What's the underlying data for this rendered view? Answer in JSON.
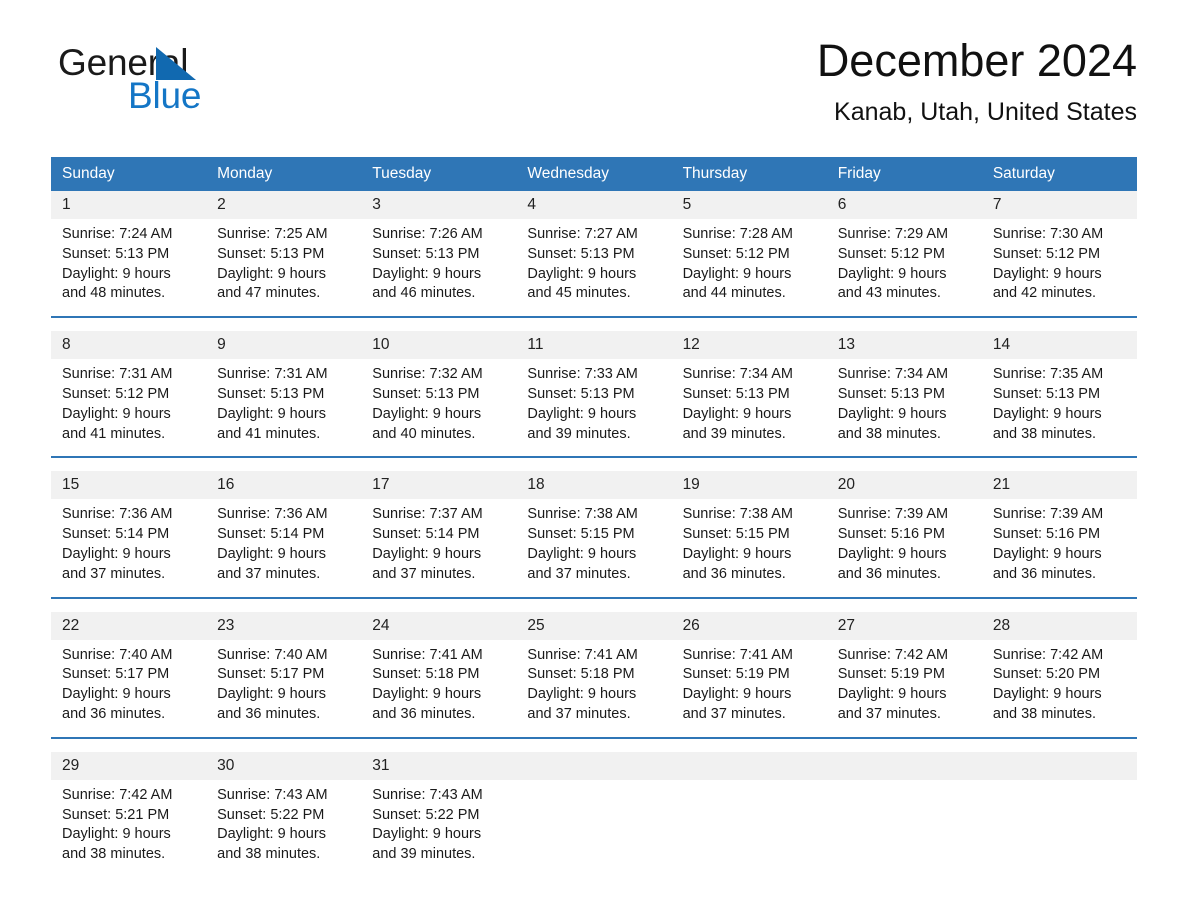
{
  "logo": {
    "word_one": "General",
    "word_two": "Blue",
    "triangle_color": "#1169b0",
    "blue_color": "#1476c6"
  },
  "header": {
    "month_title": "December 2024",
    "location": "Kanab, Utah, United States"
  },
  "colors": {
    "header_blue": "#2f76b6",
    "daynum_band": "#f1f1f1",
    "separator": "#2f76b6",
    "page_background": "#ffffff"
  },
  "calendar": {
    "weekday_headers": [
      "Sunday",
      "Monday",
      "Tuesday",
      "Wednesday",
      "Thursday",
      "Friday",
      "Saturday"
    ],
    "weeks": [
      [
        {
          "day": "1",
          "sunrise": "Sunrise: 7:24 AM",
          "sunset": "Sunset: 5:13 PM",
          "daylight_1": "Daylight: 9 hours",
          "daylight_2": "and 48 minutes."
        },
        {
          "day": "2",
          "sunrise": "Sunrise: 7:25 AM",
          "sunset": "Sunset: 5:13 PM",
          "daylight_1": "Daylight: 9 hours",
          "daylight_2": "and 47 minutes."
        },
        {
          "day": "3",
          "sunrise": "Sunrise: 7:26 AM",
          "sunset": "Sunset: 5:13 PM",
          "daylight_1": "Daylight: 9 hours",
          "daylight_2": "and 46 minutes."
        },
        {
          "day": "4",
          "sunrise": "Sunrise: 7:27 AM",
          "sunset": "Sunset: 5:13 PM",
          "daylight_1": "Daylight: 9 hours",
          "daylight_2": "and 45 minutes."
        },
        {
          "day": "5",
          "sunrise": "Sunrise: 7:28 AM",
          "sunset": "Sunset: 5:12 PM",
          "daylight_1": "Daylight: 9 hours",
          "daylight_2": "and 44 minutes."
        },
        {
          "day": "6",
          "sunrise": "Sunrise: 7:29 AM",
          "sunset": "Sunset: 5:12 PM",
          "daylight_1": "Daylight: 9 hours",
          "daylight_2": "and 43 minutes."
        },
        {
          "day": "7",
          "sunrise": "Sunrise: 7:30 AM",
          "sunset": "Sunset: 5:12 PM",
          "daylight_1": "Daylight: 9 hours",
          "daylight_2": "and 42 minutes."
        }
      ],
      [
        {
          "day": "8",
          "sunrise": "Sunrise: 7:31 AM",
          "sunset": "Sunset: 5:12 PM",
          "daylight_1": "Daylight: 9 hours",
          "daylight_2": "and 41 minutes."
        },
        {
          "day": "9",
          "sunrise": "Sunrise: 7:31 AM",
          "sunset": "Sunset: 5:13 PM",
          "daylight_1": "Daylight: 9 hours",
          "daylight_2": "and 41 minutes."
        },
        {
          "day": "10",
          "sunrise": "Sunrise: 7:32 AM",
          "sunset": "Sunset: 5:13 PM",
          "daylight_1": "Daylight: 9 hours",
          "daylight_2": "and 40 minutes."
        },
        {
          "day": "11",
          "sunrise": "Sunrise: 7:33 AM",
          "sunset": "Sunset: 5:13 PM",
          "daylight_1": "Daylight: 9 hours",
          "daylight_2": "and 39 minutes."
        },
        {
          "day": "12",
          "sunrise": "Sunrise: 7:34 AM",
          "sunset": "Sunset: 5:13 PM",
          "daylight_1": "Daylight: 9 hours",
          "daylight_2": "and 39 minutes."
        },
        {
          "day": "13",
          "sunrise": "Sunrise: 7:34 AM",
          "sunset": "Sunset: 5:13 PM",
          "daylight_1": "Daylight: 9 hours",
          "daylight_2": "and 38 minutes."
        },
        {
          "day": "14",
          "sunrise": "Sunrise: 7:35 AM",
          "sunset": "Sunset: 5:13 PM",
          "daylight_1": "Daylight: 9 hours",
          "daylight_2": "and 38 minutes."
        }
      ],
      [
        {
          "day": "15",
          "sunrise": "Sunrise: 7:36 AM",
          "sunset": "Sunset: 5:14 PM",
          "daylight_1": "Daylight: 9 hours",
          "daylight_2": "and 37 minutes."
        },
        {
          "day": "16",
          "sunrise": "Sunrise: 7:36 AM",
          "sunset": "Sunset: 5:14 PM",
          "daylight_1": "Daylight: 9 hours",
          "daylight_2": "and 37 minutes."
        },
        {
          "day": "17",
          "sunrise": "Sunrise: 7:37 AM",
          "sunset": "Sunset: 5:14 PM",
          "daylight_1": "Daylight: 9 hours",
          "daylight_2": "and 37 minutes."
        },
        {
          "day": "18",
          "sunrise": "Sunrise: 7:38 AM",
          "sunset": "Sunset: 5:15 PM",
          "daylight_1": "Daylight: 9 hours",
          "daylight_2": "and 37 minutes."
        },
        {
          "day": "19",
          "sunrise": "Sunrise: 7:38 AM",
          "sunset": "Sunset: 5:15 PM",
          "daylight_1": "Daylight: 9 hours",
          "daylight_2": "and 36 minutes."
        },
        {
          "day": "20",
          "sunrise": "Sunrise: 7:39 AM",
          "sunset": "Sunset: 5:16 PM",
          "daylight_1": "Daylight: 9 hours",
          "daylight_2": "and 36 minutes."
        },
        {
          "day": "21",
          "sunrise": "Sunrise: 7:39 AM",
          "sunset": "Sunset: 5:16 PM",
          "daylight_1": "Daylight: 9 hours",
          "daylight_2": "and 36 minutes."
        }
      ],
      [
        {
          "day": "22",
          "sunrise": "Sunrise: 7:40 AM",
          "sunset": "Sunset: 5:17 PM",
          "daylight_1": "Daylight: 9 hours",
          "daylight_2": "and 36 minutes."
        },
        {
          "day": "23",
          "sunrise": "Sunrise: 7:40 AM",
          "sunset": "Sunset: 5:17 PM",
          "daylight_1": "Daylight: 9 hours",
          "daylight_2": "and 36 minutes."
        },
        {
          "day": "24",
          "sunrise": "Sunrise: 7:41 AM",
          "sunset": "Sunset: 5:18 PM",
          "daylight_1": "Daylight: 9 hours",
          "daylight_2": "and 36 minutes."
        },
        {
          "day": "25",
          "sunrise": "Sunrise: 7:41 AM",
          "sunset": "Sunset: 5:18 PM",
          "daylight_1": "Daylight: 9 hours",
          "daylight_2": "and 37 minutes."
        },
        {
          "day": "26",
          "sunrise": "Sunrise: 7:41 AM",
          "sunset": "Sunset: 5:19 PM",
          "daylight_1": "Daylight: 9 hours",
          "daylight_2": "and 37 minutes."
        },
        {
          "day": "27",
          "sunrise": "Sunrise: 7:42 AM",
          "sunset": "Sunset: 5:19 PM",
          "daylight_1": "Daylight: 9 hours",
          "daylight_2": "and 37 minutes."
        },
        {
          "day": "28",
          "sunrise": "Sunrise: 7:42 AM",
          "sunset": "Sunset: 5:20 PM",
          "daylight_1": "Daylight: 9 hours",
          "daylight_2": "and 38 minutes."
        }
      ],
      [
        {
          "day": "29",
          "sunrise": "Sunrise: 7:42 AM",
          "sunset": "Sunset: 5:21 PM",
          "daylight_1": "Daylight: 9 hours",
          "daylight_2": "and 38 minutes."
        },
        {
          "day": "30",
          "sunrise": "Sunrise: 7:43 AM",
          "sunset": "Sunset: 5:22 PM",
          "daylight_1": "Daylight: 9 hours",
          "daylight_2": "and 38 minutes."
        },
        {
          "day": "31",
          "sunrise": "Sunrise: 7:43 AM",
          "sunset": "Sunset: 5:22 PM",
          "daylight_1": "Daylight: 9 hours",
          "daylight_2": "and 39 minutes."
        },
        {
          "day": "",
          "sunrise": "",
          "sunset": "",
          "daylight_1": "",
          "daylight_2": ""
        },
        {
          "day": "",
          "sunrise": "",
          "sunset": "",
          "daylight_1": "",
          "daylight_2": ""
        },
        {
          "day": "",
          "sunrise": "",
          "sunset": "",
          "daylight_1": "",
          "daylight_2": ""
        },
        {
          "day": "",
          "sunrise": "",
          "sunset": "",
          "daylight_1": "",
          "daylight_2": ""
        }
      ]
    ]
  }
}
